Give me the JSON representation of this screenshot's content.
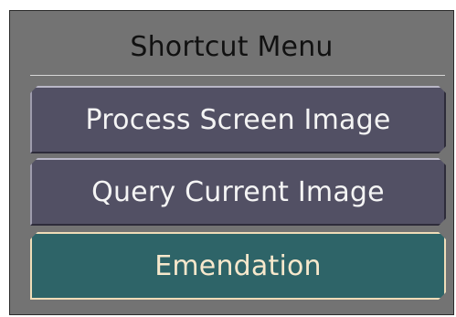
{
  "menu": {
    "title": "Shortcut Menu",
    "items": [
      {
        "label": "Process Screen Image",
        "state": "default"
      },
      {
        "label": "Query Current Image",
        "state": "default"
      },
      {
        "label": "Emendation",
        "state": "highlighted"
      }
    ]
  },
  "colors": {
    "panel_bg": "#737373",
    "button_bg": "#525064",
    "button_active_bg": "#2e6468",
    "button_active_text": "#f7e8cc"
  }
}
